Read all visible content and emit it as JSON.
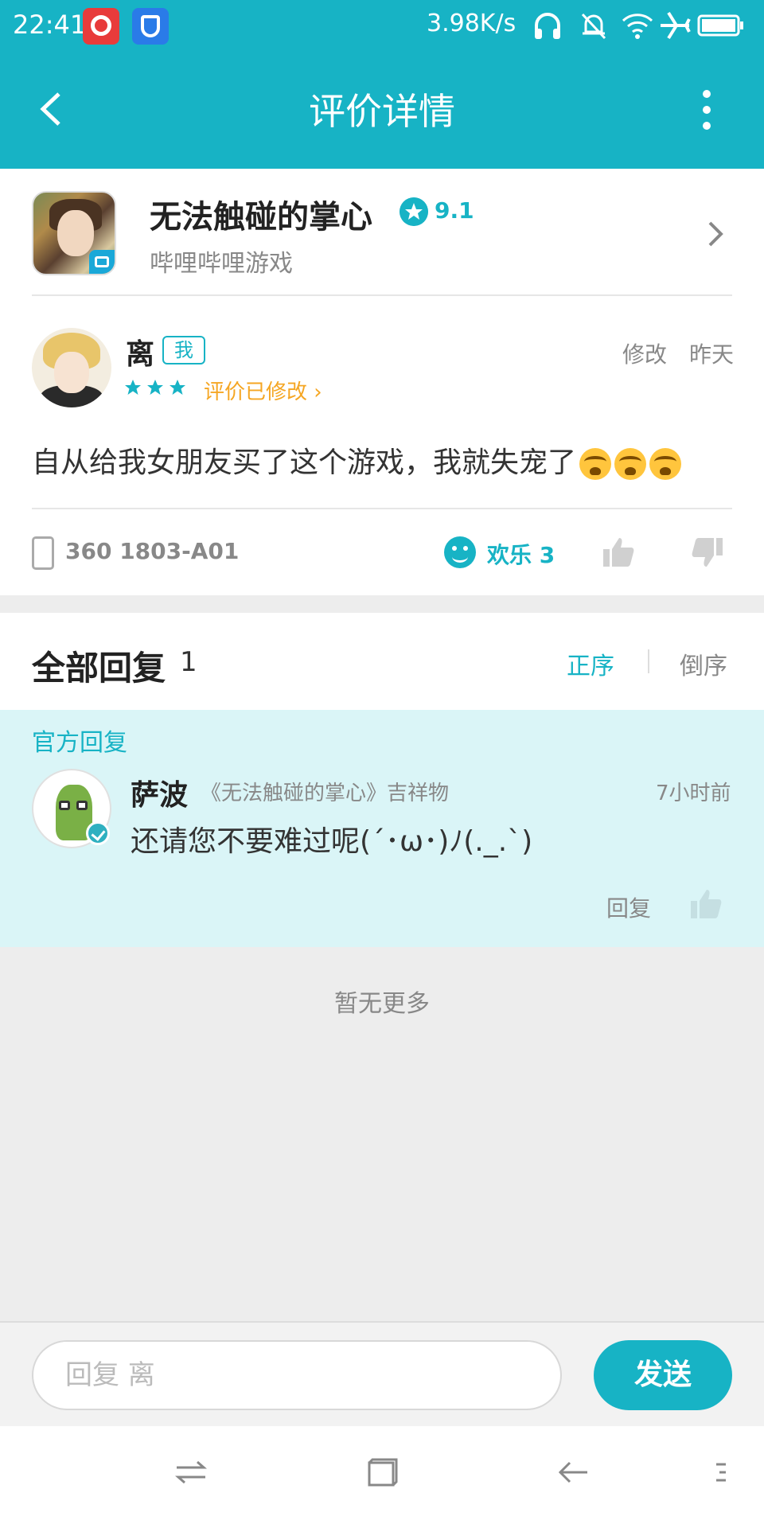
{
  "status_bar": {
    "time": "22:41",
    "net_speed": "3.98K/s"
  },
  "header": {
    "title": "评价详情"
  },
  "game": {
    "name": "无法触碰的掌心",
    "rating": "9.1",
    "publisher": "哔哩哔哩游戏"
  },
  "review": {
    "user_name": "离",
    "me_tag": "我",
    "stars": 3,
    "edited_label": "评价已修改 ›",
    "edit_link": "修改",
    "time": "昨天",
    "text": "自从给我女朋友买了这个游戏，我就失宠了",
    "device": "360 1803-A01",
    "reaction_label": "欢乐 3"
  },
  "replies": {
    "title": "全部回复",
    "count": "1",
    "sort_asc": "正序",
    "sort_desc": "倒序",
    "items": [
      {
        "badge": "官方回复",
        "name": "萨波",
        "title": "《无法触碰的掌心》吉祥物",
        "time": "7小时前",
        "text": "还请您不要难过呢(´･ω･)ﾉ(._.`)",
        "reply_label": "回复"
      }
    ],
    "end_text": "暂无更多"
  },
  "composer": {
    "placeholder": "回复 离",
    "send_label": "发送"
  },
  "colors": {
    "accent": "#17b3c5",
    "edited": "#f5a623",
    "official_bg": "#daf5f7"
  }
}
